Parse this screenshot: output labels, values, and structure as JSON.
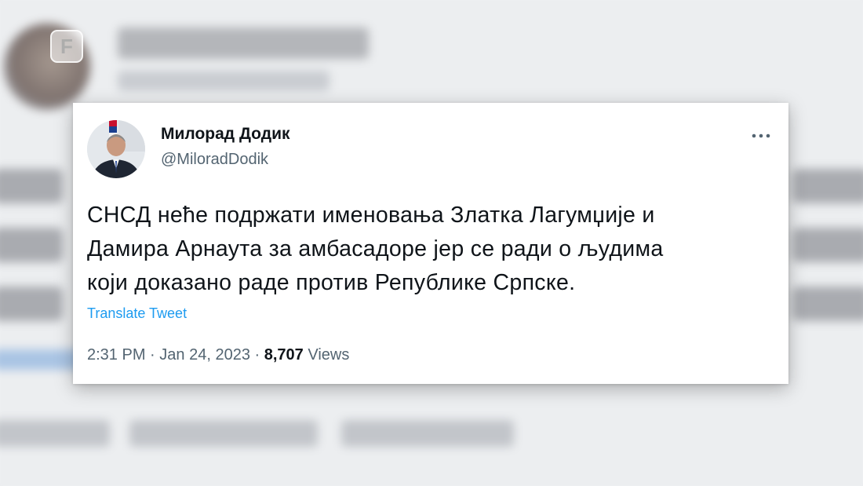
{
  "watermark": {
    "letter": "F"
  },
  "tweet": {
    "author_name": "Милорад Додик",
    "handle": "@MiloradDodik",
    "text_lines": [
      "СНСД неће подржати именовања Златка Лагумџије и",
      "Дамира Арнаута за амбасадоре јер се ради о људима",
      "који доказано раде против Републике Српске."
    ],
    "translate_label": "Translate Tweet",
    "time": "2:31 PM",
    "separator": "·",
    "date": "Jan 24, 2023",
    "views_count": "8,707",
    "views_label": "Views"
  },
  "icons": {
    "more": "more-horizontal-icon",
    "avatar": "profile-avatar"
  },
  "colors": {
    "primary_text": "#0f1419",
    "secondary_text": "#536471",
    "link": "#1d9bf0",
    "card_bg": "#ffffff",
    "page_bg": "#e9eaec"
  }
}
